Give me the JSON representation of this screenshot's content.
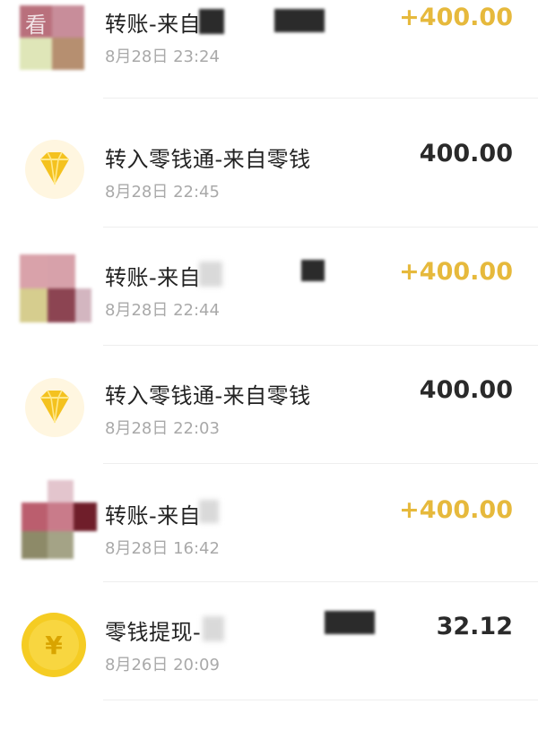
{
  "transactions": [
    {
      "title": "转账-来自",
      "date": "8月28日 23:24",
      "amount": "+400.00",
      "icon": "contact-avatar",
      "direction": "in"
    },
    {
      "title": "转入零钱通-来自零钱",
      "date": "8月28日 22:45",
      "amount": "400.00",
      "icon": "diamond-icon",
      "direction": "neutral"
    },
    {
      "title": "转账-来自",
      "date": "8月28日 22:44",
      "amount": "+400.00",
      "icon": "contact-avatar",
      "direction": "in"
    },
    {
      "title": "转入零钱通-来自零钱",
      "date": "8月28日 22:03",
      "amount": "400.00",
      "icon": "diamond-icon",
      "direction": "neutral"
    },
    {
      "title": "转账-来自",
      "date": "8月28日 16:42",
      "amount": "+400.00",
      "icon": "contact-avatar",
      "direction": "in"
    },
    {
      "title": "零钱提现-",
      "date": "8月26日 20:09",
      "amount": "32.12",
      "icon": "yuan-coin-icon",
      "direction": "neutral"
    }
  ],
  "watermark": "看",
  "coin_symbol": "¥",
  "colors": {
    "income": "#e6b93c",
    "amount_default": "#2a2a2a",
    "diamond": "#f4c21f",
    "coin": "#f5cc23"
  }
}
